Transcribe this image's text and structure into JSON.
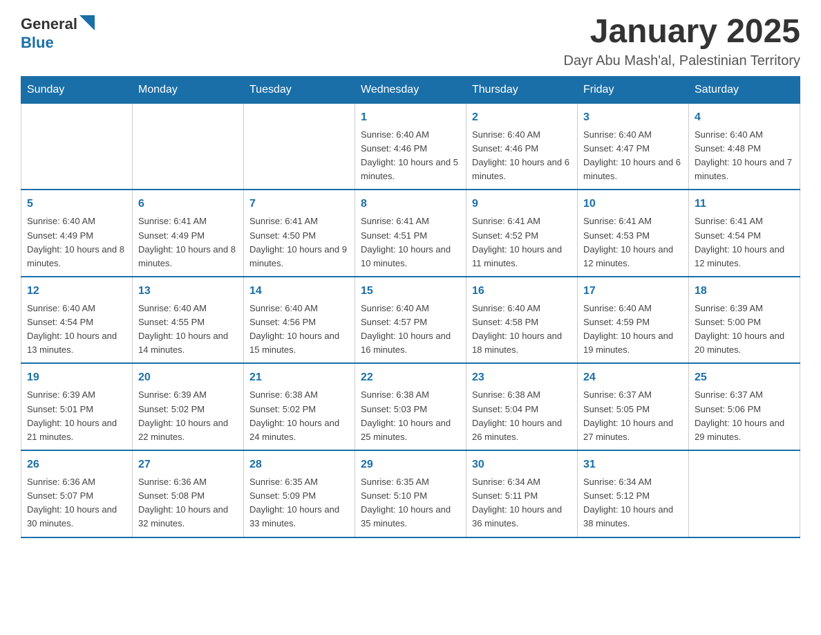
{
  "logo": {
    "text_general": "General",
    "text_blue": "Blue"
  },
  "header": {
    "title": "January 2025",
    "subtitle": "Dayr Abu Mash'al, Palestinian Territory"
  },
  "days_of_week": [
    "Sunday",
    "Monday",
    "Tuesday",
    "Wednesday",
    "Thursday",
    "Friday",
    "Saturday"
  ],
  "weeks": [
    [
      {
        "day": "",
        "info": ""
      },
      {
        "day": "",
        "info": ""
      },
      {
        "day": "",
        "info": ""
      },
      {
        "day": "1",
        "info": "Sunrise: 6:40 AM\nSunset: 4:46 PM\nDaylight: 10 hours and 5 minutes."
      },
      {
        "day": "2",
        "info": "Sunrise: 6:40 AM\nSunset: 4:46 PM\nDaylight: 10 hours and 6 minutes."
      },
      {
        "day": "3",
        "info": "Sunrise: 6:40 AM\nSunset: 4:47 PM\nDaylight: 10 hours and 6 minutes."
      },
      {
        "day": "4",
        "info": "Sunrise: 6:40 AM\nSunset: 4:48 PM\nDaylight: 10 hours and 7 minutes."
      }
    ],
    [
      {
        "day": "5",
        "info": "Sunrise: 6:40 AM\nSunset: 4:49 PM\nDaylight: 10 hours and 8 minutes."
      },
      {
        "day": "6",
        "info": "Sunrise: 6:41 AM\nSunset: 4:49 PM\nDaylight: 10 hours and 8 minutes."
      },
      {
        "day": "7",
        "info": "Sunrise: 6:41 AM\nSunset: 4:50 PM\nDaylight: 10 hours and 9 minutes."
      },
      {
        "day": "8",
        "info": "Sunrise: 6:41 AM\nSunset: 4:51 PM\nDaylight: 10 hours and 10 minutes."
      },
      {
        "day": "9",
        "info": "Sunrise: 6:41 AM\nSunset: 4:52 PM\nDaylight: 10 hours and 11 minutes."
      },
      {
        "day": "10",
        "info": "Sunrise: 6:41 AM\nSunset: 4:53 PM\nDaylight: 10 hours and 12 minutes."
      },
      {
        "day": "11",
        "info": "Sunrise: 6:41 AM\nSunset: 4:54 PM\nDaylight: 10 hours and 12 minutes."
      }
    ],
    [
      {
        "day": "12",
        "info": "Sunrise: 6:40 AM\nSunset: 4:54 PM\nDaylight: 10 hours and 13 minutes."
      },
      {
        "day": "13",
        "info": "Sunrise: 6:40 AM\nSunset: 4:55 PM\nDaylight: 10 hours and 14 minutes."
      },
      {
        "day": "14",
        "info": "Sunrise: 6:40 AM\nSunset: 4:56 PM\nDaylight: 10 hours and 15 minutes."
      },
      {
        "day": "15",
        "info": "Sunrise: 6:40 AM\nSunset: 4:57 PM\nDaylight: 10 hours and 16 minutes."
      },
      {
        "day": "16",
        "info": "Sunrise: 6:40 AM\nSunset: 4:58 PM\nDaylight: 10 hours and 18 minutes."
      },
      {
        "day": "17",
        "info": "Sunrise: 6:40 AM\nSunset: 4:59 PM\nDaylight: 10 hours and 19 minutes."
      },
      {
        "day": "18",
        "info": "Sunrise: 6:39 AM\nSunset: 5:00 PM\nDaylight: 10 hours and 20 minutes."
      }
    ],
    [
      {
        "day": "19",
        "info": "Sunrise: 6:39 AM\nSunset: 5:01 PM\nDaylight: 10 hours and 21 minutes."
      },
      {
        "day": "20",
        "info": "Sunrise: 6:39 AM\nSunset: 5:02 PM\nDaylight: 10 hours and 22 minutes."
      },
      {
        "day": "21",
        "info": "Sunrise: 6:38 AM\nSunset: 5:02 PM\nDaylight: 10 hours and 24 minutes."
      },
      {
        "day": "22",
        "info": "Sunrise: 6:38 AM\nSunset: 5:03 PM\nDaylight: 10 hours and 25 minutes."
      },
      {
        "day": "23",
        "info": "Sunrise: 6:38 AM\nSunset: 5:04 PM\nDaylight: 10 hours and 26 minutes."
      },
      {
        "day": "24",
        "info": "Sunrise: 6:37 AM\nSunset: 5:05 PM\nDaylight: 10 hours and 27 minutes."
      },
      {
        "day": "25",
        "info": "Sunrise: 6:37 AM\nSunset: 5:06 PM\nDaylight: 10 hours and 29 minutes."
      }
    ],
    [
      {
        "day": "26",
        "info": "Sunrise: 6:36 AM\nSunset: 5:07 PM\nDaylight: 10 hours and 30 minutes."
      },
      {
        "day": "27",
        "info": "Sunrise: 6:36 AM\nSunset: 5:08 PM\nDaylight: 10 hours and 32 minutes."
      },
      {
        "day": "28",
        "info": "Sunrise: 6:35 AM\nSunset: 5:09 PM\nDaylight: 10 hours and 33 minutes."
      },
      {
        "day": "29",
        "info": "Sunrise: 6:35 AM\nSunset: 5:10 PM\nDaylight: 10 hours and 35 minutes."
      },
      {
        "day": "30",
        "info": "Sunrise: 6:34 AM\nSunset: 5:11 PM\nDaylight: 10 hours and 36 minutes."
      },
      {
        "day": "31",
        "info": "Sunrise: 6:34 AM\nSunset: 5:12 PM\nDaylight: 10 hours and 38 minutes."
      },
      {
        "day": "",
        "info": ""
      }
    ]
  ]
}
